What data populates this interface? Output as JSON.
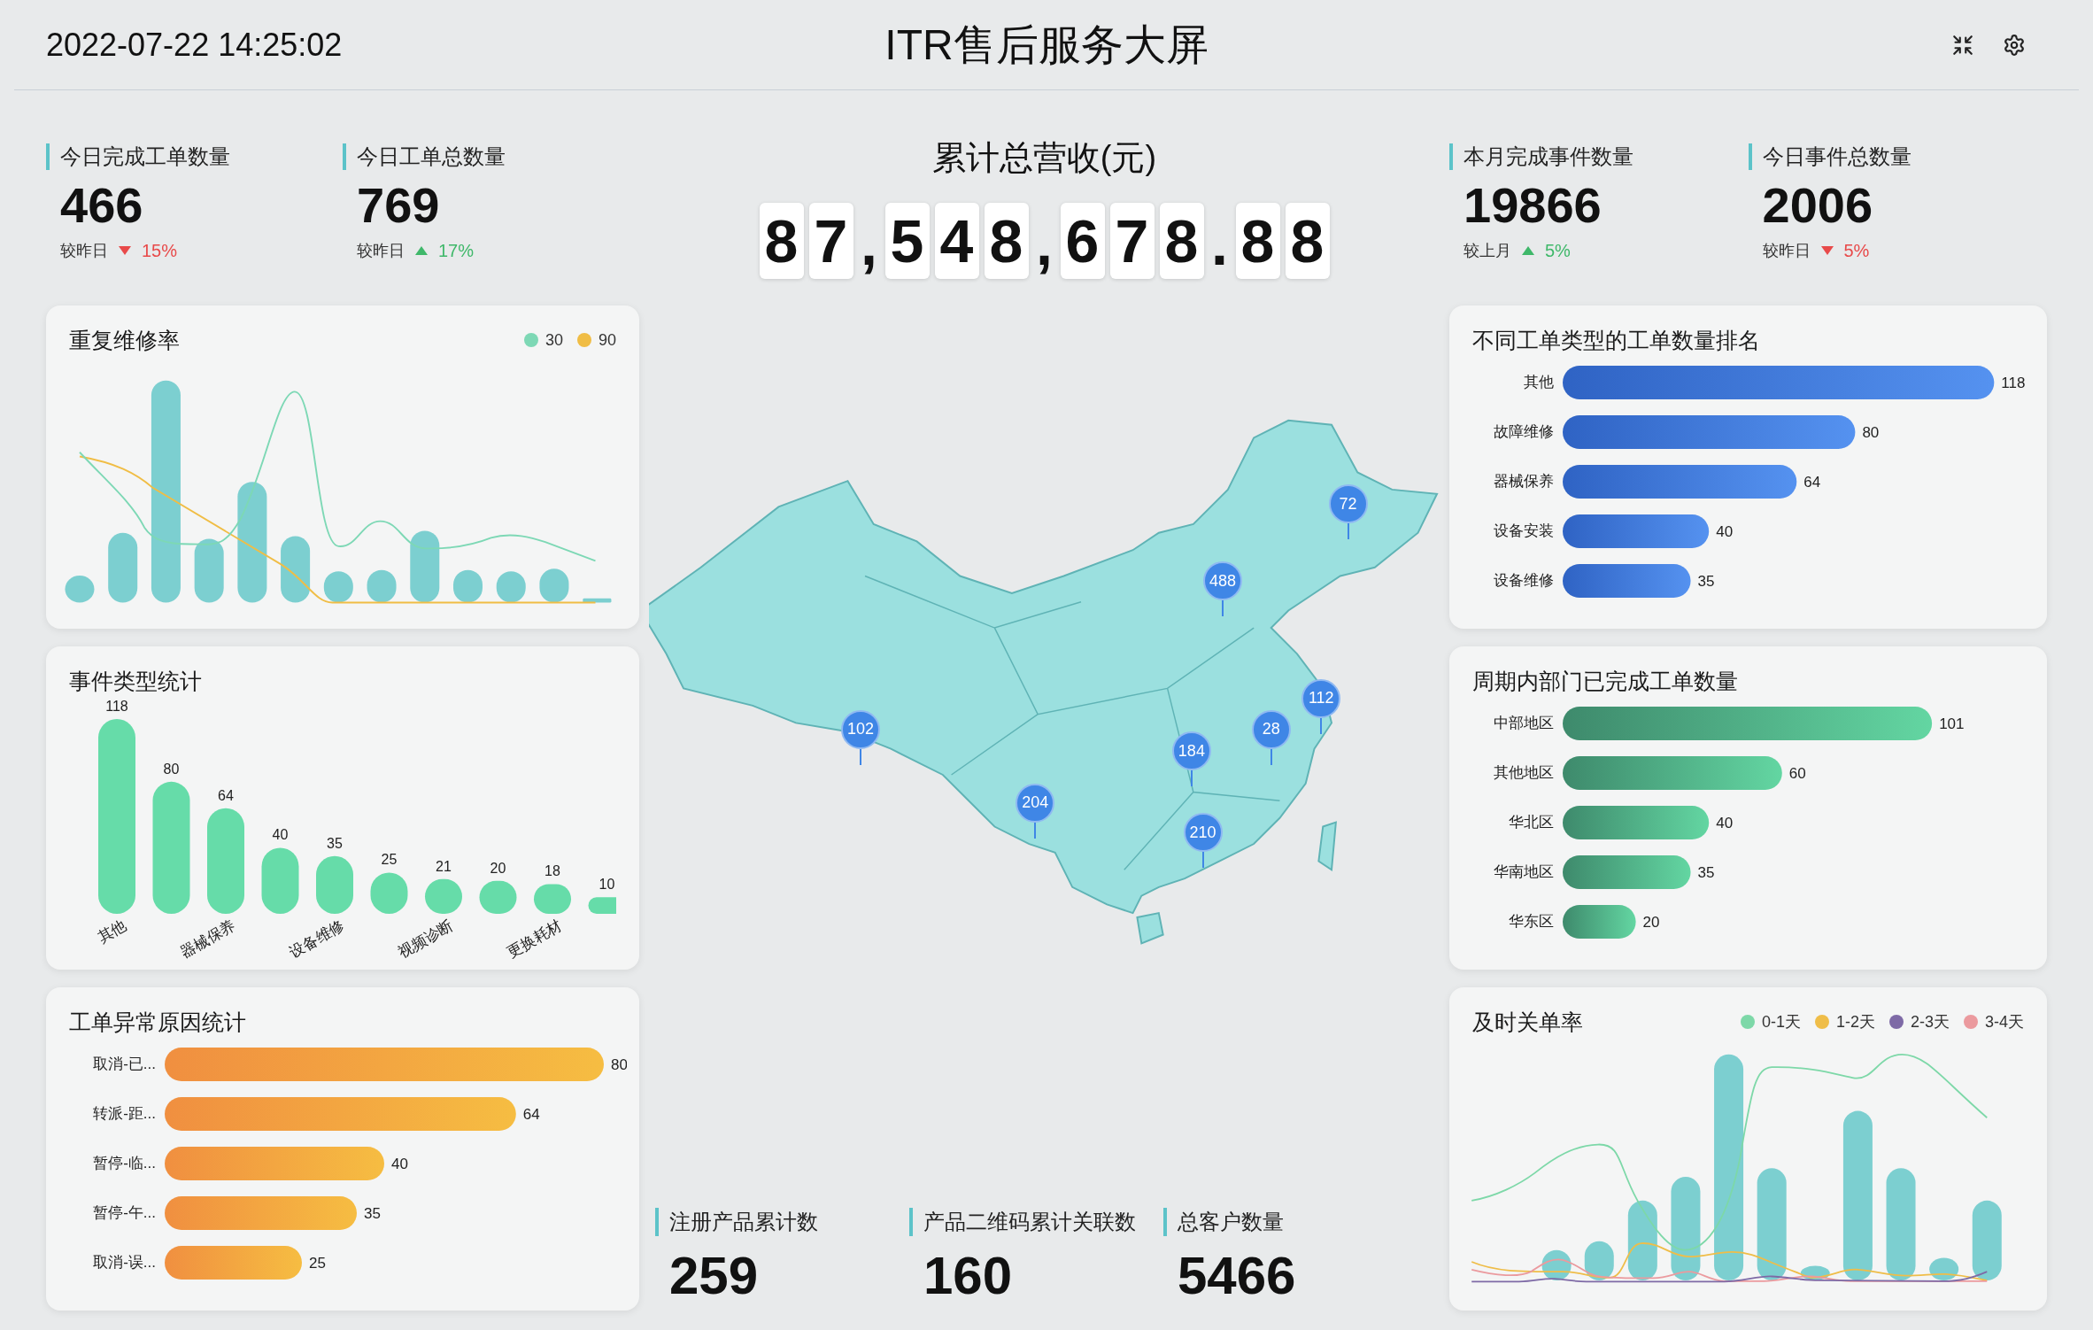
{
  "header": {
    "datetime": "2022-07-22 14:25:02",
    "title": "ITR售后服务大屏"
  },
  "stats_left": [
    {
      "label": "今日完成工单数量",
      "value": "466",
      "compare": "较昨日",
      "increase": false,
      "change": "15%"
    },
    {
      "label": "今日工单总数量",
      "value": "769",
      "compare": "较昨日",
      "increase": true,
      "change": "17%"
    }
  ],
  "revenue": {
    "label": "累计总营收(元)",
    "parts": [
      {
        "kind": "digit",
        "text": "8"
      },
      {
        "kind": "digit",
        "text": "7"
      },
      {
        "kind": "separator",
        "text": ","
      },
      {
        "kind": "digit",
        "text": "5"
      },
      {
        "kind": "digit",
        "text": "4"
      },
      {
        "kind": "digit",
        "text": "8"
      },
      {
        "kind": "separator",
        "text": ","
      },
      {
        "kind": "digit",
        "text": "6"
      },
      {
        "kind": "digit",
        "text": "7"
      },
      {
        "kind": "digit",
        "text": "8"
      },
      {
        "kind": "separator",
        "text": "."
      },
      {
        "kind": "digit",
        "text": "8"
      },
      {
        "kind": "digit",
        "text": "8"
      }
    ]
  },
  "stats_right": [
    {
      "label": "本月完成事件数量",
      "value": "19866",
      "compare": "较上月",
      "increase": true,
      "change": "5%"
    },
    {
      "label": "今日事件总数量",
      "value": "2006",
      "compare": "较昨日",
      "increase": false,
      "change": "5%"
    }
  ],
  "repeat_repair": {
    "title": "重复维修率",
    "legend": [
      {
        "label": "30",
        "color": "#7dd8b5"
      },
      {
        "label": "90",
        "color": "#f0bd45"
      }
    ]
  },
  "event_types": {
    "title": "事件类型统计",
    "chart_data": {
      "type": "bar",
      "categories": [
        "其他",
        null,
        "器械保养",
        null,
        "设备维修",
        null,
        "视频诊断",
        null,
        "更换耗材",
        null
      ],
      "values": [
        118,
        80,
        64,
        40,
        35,
        25,
        21,
        20,
        18,
        10
      ],
      "data_labels": true
    }
  },
  "abnormal_reasons": {
    "title": "工单异常原因统计",
    "chart_data": {
      "type": "bar",
      "orientation": "horizontal",
      "categories": [
        "取消-已...",
        "转派-距...",
        "暂停-临...",
        "暂停-午...",
        "取消-误..."
      ],
      "values": [
        80,
        64,
        40,
        35,
        25
      ],
      "data_labels": true
    }
  },
  "map": {
    "pins": [
      {
        "label": "72"
      },
      {
        "label": "488"
      },
      {
        "label": "102"
      },
      {
        "label": "28"
      },
      {
        "label": "112"
      },
      {
        "label": "184"
      },
      {
        "label": "204"
      },
      {
        "label": "210"
      }
    ]
  },
  "bottom_stats": [
    {
      "label": "注册产品累计数",
      "value": "259"
    },
    {
      "label": "产品二维码累计关联数",
      "value": "160"
    },
    {
      "label": "总客户数量",
      "value": "5466"
    }
  ],
  "work_order_types": {
    "title": "不同工单类型的工单数量排名",
    "chart_data": {
      "type": "bar",
      "orientation": "horizontal",
      "categories": [
        "其他",
        "故障维修",
        "器械保养",
        "设备安装",
        "设备维修"
      ],
      "values": [
        118,
        80,
        64,
        40,
        35
      ],
      "data_labels": true
    }
  },
  "department_completed": {
    "title": "周期内部门已完成工单数量",
    "chart_data": {
      "type": "bar",
      "orientation": "horizontal",
      "categories": [
        "中部地区",
        "其他地区",
        "华北区",
        "华南地区",
        "华东区"
      ],
      "values": [
        101,
        60,
        40,
        35,
        20
      ],
      "data_labels": true
    }
  },
  "close_rate": {
    "title": "及时关单率",
    "legend": [
      {
        "label": "0-1天",
        "color": "#7dd8a8"
      },
      {
        "label": "1-2天",
        "color": "#efbd48"
      },
      {
        "label": "2-3天",
        "color": "#7e6aa6"
      },
      {
        "label": "3-4天",
        "color": "#eb9a9e"
      }
    ]
  }
}
